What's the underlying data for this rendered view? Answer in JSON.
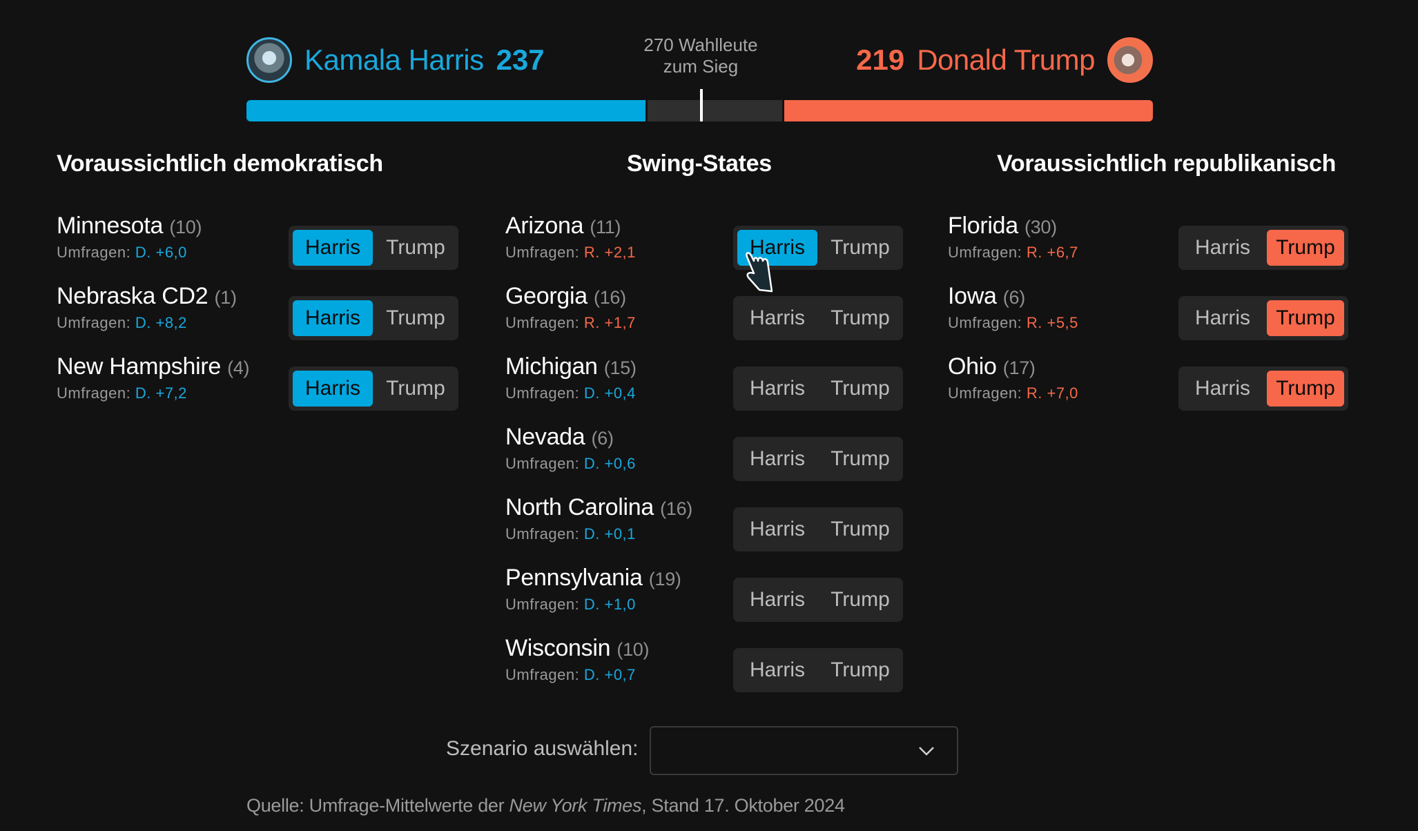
{
  "header": {
    "harris": {
      "name": "Kamala Harris",
      "votes": "237",
      "electoral_votes": 237,
      "avatar_icon": "harris-portrait",
      "color": "#00a8df"
    },
    "trump": {
      "name": "Donald Trump",
      "votes": "219",
      "electoral_votes": 219,
      "avatar_icon": "trump-portrait",
      "color": "#f7674a"
    },
    "goal_line1": "270 Wahlleute",
    "goal_line2": "zum Sieg",
    "threshold": 270,
    "total": 538
  },
  "columns": {
    "dem": {
      "title": "Voraussichtlich demokratisch"
    },
    "swing": {
      "title": "Swing-States"
    },
    "rep": {
      "title": "Voraussichtlich republikanisch"
    }
  },
  "poll_prefix": "Umfragen:",
  "toggle_labels": {
    "harris": "Harris",
    "trump": "Trump"
  },
  "states": {
    "dem": [
      {
        "name": "Minnesota",
        "ev": "(10)",
        "party": "D.",
        "margin": "+6,0",
        "lean": "d",
        "selected": "harris"
      },
      {
        "name": "Nebraska CD2",
        "ev": "(1)",
        "party": "D.",
        "margin": "+8,2",
        "lean": "d",
        "selected": "harris"
      },
      {
        "name": "New Hampshire",
        "ev": "(4)",
        "party": "D.",
        "margin": "+7,2",
        "lean": "d",
        "selected": "harris"
      }
    ],
    "swing": [
      {
        "name": "Arizona",
        "ev": "(11)",
        "party": "R.",
        "margin": "+2,1",
        "lean": "r",
        "selected": "harris"
      },
      {
        "name": "Georgia",
        "ev": "(16)",
        "party": "R.",
        "margin": "+1,7",
        "lean": "r",
        "selected": "none"
      },
      {
        "name": "Michigan",
        "ev": "(15)",
        "party": "D.",
        "margin": "+0,4",
        "lean": "d",
        "selected": "none"
      },
      {
        "name": "Nevada",
        "ev": "(6)",
        "party": "D.",
        "margin": "+0,6",
        "lean": "d",
        "selected": "none"
      },
      {
        "name": "North Carolina",
        "ev": "(16)",
        "party": "D.",
        "margin": "+0,1",
        "lean": "d",
        "selected": "none"
      },
      {
        "name": "Pennsylvania",
        "ev": "(19)",
        "party": "D.",
        "margin": "+1,0",
        "lean": "d",
        "selected": "none"
      },
      {
        "name": "Wisconsin",
        "ev": "(10)",
        "party": "D.",
        "margin": "+0,7",
        "lean": "d",
        "selected": "none"
      }
    ],
    "rep": [
      {
        "name": "Florida",
        "ev": "(30)",
        "party": "R.",
        "margin": "+6,7",
        "lean": "r",
        "selected": "trump"
      },
      {
        "name": "Iowa",
        "ev": "(6)",
        "party": "R.",
        "margin": "+5,5",
        "lean": "r",
        "selected": "trump"
      },
      {
        "name": "Ohio",
        "ev": "(17)",
        "party": "R.",
        "margin": "+7,0",
        "lean": "r",
        "selected": "trump"
      }
    ]
  },
  "scenario": {
    "label": "Szenario auswählen:",
    "value": "",
    "icon": "chevron-down-icon"
  },
  "source": {
    "prefix": "Quelle: Umfrage-Mittelwerte der ",
    "publication": "New York Times",
    "suffix": ", Stand 17. Oktober 2024"
  },
  "cursor": {
    "icon": "hand-pointer-icon"
  }
}
